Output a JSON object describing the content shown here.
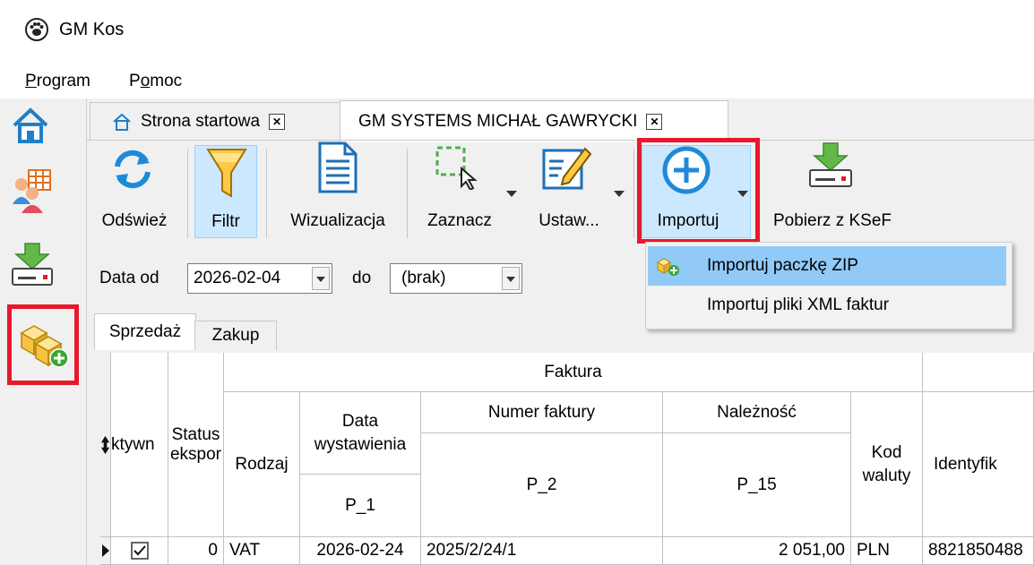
{
  "window": {
    "title": "GM Kos",
    "app_icon": "paw-icon"
  },
  "menu": {
    "items": [
      {
        "label": "Program",
        "mnemonic": "P"
      },
      {
        "label": "Pomoc",
        "mnemonic": "o"
      }
    ]
  },
  "sidebar": {
    "items": [
      {
        "icon": "home-icon"
      },
      {
        "icon": "contractors-icon"
      },
      {
        "icon": "download-drive-icon"
      },
      {
        "icon": "add-package-icon",
        "highlighted": true
      }
    ]
  },
  "tabs": [
    {
      "label": "Strona startowa",
      "icon": "home-icon",
      "active": false
    },
    {
      "label": "GM SYSTEMS MICHAŁ GAWRYCKI",
      "active": true
    }
  ],
  "toolbar": {
    "refresh": "Odśwież",
    "filter": "Filtr",
    "visualization": "Wizualizacja",
    "select": "Zaznacz",
    "settings": "Ustaw...",
    "import": "Importuj",
    "fetch": "Pobierz z KSeF"
  },
  "filters": {
    "date_from_label": "Data od",
    "date_from": "2026-02-04",
    "date_to_label": "do",
    "date_to": "(brak)"
  },
  "subtabs": [
    {
      "label": "Sprzedaż",
      "active": true
    },
    {
      "label": "Zakup",
      "active": false
    }
  ],
  "import_menu": {
    "items": [
      "Importuj paczkę ZIP",
      "Importuj pliki XML faktur"
    ],
    "selected_index": 0
  },
  "grid": {
    "group_header": "Faktura",
    "headers": {
      "active": "ktywn",
      "status_1": "Status",
      "status_2": "ekspor",
      "kind": "Rodzaj",
      "date_1": "Data",
      "date_2": "wystawienia",
      "date_code": "P_1",
      "number": "Numer faktury",
      "number_code": "P_2",
      "amount": "Należność",
      "amount_code": "P_15",
      "currency_1": "Kod",
      "currency_2": "waluty",
      "ident": "Identyfik"
    },
    "rows": [
      {
        "active": true,
        "status": "0",
        "kind": "VAT",
        "date": "2026-02-24",
        "number": "2025/2/24/1",
        "amount": "2 051,00",
        "currency": "PLN",
        "ident": "8821850488"
      }
    ]
  },
  "colors": {
    "highlight": "#e8182c",
    "selection": "#cce8ff",
    "menu_hover": "#91c9f7"
  }
}
